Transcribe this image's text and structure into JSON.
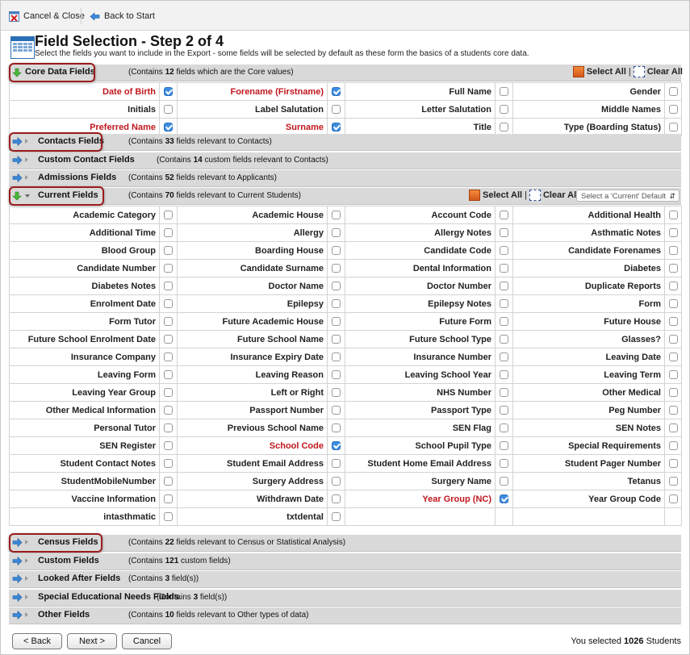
{
  "toolbar": {
    "cancel_close": "Cancel & Close",
    "back_to_start": "Back to Start"
  },
  "header": {
    "title": "Field Selection - Step 2 of 4",
    "subtitle": "Select the fields you want to include in the Export - some fields will be selected by default as these form the basics of a students core data."
  },
  "colors": {
    "accent": "#2a6fb6",
    "required_red": "#c0171e",
    "highlight": "#9b1c1c",
    "section_bg": "#d9d9d9"
  },
  "core": {
    "name": "Core Data Fields",
    "desc_pre": "(Contains ",
    "count": "12",
    "desc_post": " fields which are the Core values)",
    "select_all": "Select All",
    "sep": " | ",
    "clear_all": "Clear All",
    "rows": [
      [
        {
          "label": "Date of Birth",
          "checked": true,
          "red": true
        },
        {
          "label": "Forename (Firstname)",
          "checked": true,
          "red": true
        },
        {
          "label": "Full Name",
          "checked": false,
          "red": false
        },
        {
          "label": "Gender",
          "checked": false,
          "red": false
        }
      ],
      [
        {
          "label": "Initials",
          "checked": false,
          "red": false
        },
        {
          "label": "Label Salutation",
          "checked": false,
          "red": false
        },
        {
          "label": "Letter Salutation",
          "checked": false,
          "red": false
        },
        {
          "label": "Middle Names",
          "checked": false,
          "red": false
        }
      ],
      [
        {
          "label": "Preferred Name",
          "checked": true,
          "red": true
        },
        {
          "label": "Surname",
          "checked": true,
          "red": true
        },
        {
          "label": "Title",
          "checked": false,
          "red": false
        },
        {
          "label": "Type (Boarding Status)",
          "checked": false,
          "red": false
        }
      ]
    ]
  },
  "sections_before": [
    {
      "name": "Contacts Fields",
      "desc_pre": "(Contains ",
      "count": "33",
      "desc_post": " fields relevant to Contacts)"
    },
    {
      "name": "Custom Contact Fields",
      "desc_pre": "(Contains ",
      "count": "14",
      "desc_post": " custom fields relevant to Contacts)"
    },
    {
      "name": "Admissions Fields",
      "desc_pre": "(Contains ",
      "count": "52",
      "desc_post": " fields relevant to Applicants)"
    }
  ],
  "current": {
    "name": "Current Fields",
    "desc_pre": "(Contains ",
    "count": "70",
    "desc_post": " fields relevant to Current Students)",
    "select_all": "Select All",
    "sep": " | ",
    "clear_all": "Clear All",
    "default_placeholder": "Select a 'Current' Default",
    "rows": [
      [
        {
          "label": "Academic Category",
          "checked": false,
          "red": false
        },
        {
          "label": "Academic House",
          "checked": false,
          "red": false
        },
        {
          "label": "Account Code",
          "checked": false,
          "red": false
        },
        {
          "label": "Additional Health",
          "checked": false,
          "red": false
        }
      ],
      [
        {
          "label": "Additional Time",
          "checked": false,
          "red": false
        },
        {
          "label": "Allergy",
          "checked": false,
          "red": false
        },
        {
          "label": "Allergy Notes",
          "checked": false,
          "red": false
        },
        {
          "label": "Asthmatic Notes",
          "checked": false,
          "red": false
        }
      ],
      [
        {
          "label": "Blood Group",
          "checked": false,
          "red": false
        },
        {
          "label": "Boarding House",
          "checked": false,
          "red": false
        },
        {
          "label": "Candidate Code",
          "checked": false,
          "red": false
        },
        {
          "label": "Candidate Forenames",
          "checked": false,
          "red": false
        }
      ],
      [
        {
          "label": "Candidate Number",
          "checked": false,
          "red": false
        },
        {
          "label": "Candidate Surname",
          "checked": false,
          "red": false
        },
        {
          "label": "Dental Information",
          "checked": false,
          "red": false
        },
        {
          "label": "Diabetes",
          "checked": false,
          "red": false
        }
      ],
      [
        {
          "label": "Diabetes Notes",
          "checked": false,
          "red": false
        },
        {
          "label": "Doctor Name",
          "checked": false,
          "red": false
        },
        {
          "label": "Doctor Number",
          "checked": false,
          "red": false
        },
        {
          "label": "Duplicate Reports",
          "checked": false,
          "red": false
        }
      ],
      [
        {
          "label": "Enrolment Date",
          "checked": false,
          "red": false
        },
        {
          "label": "Epilepsy",
          "checked": false,
          "red": false
        },
        {
          "label": "Epilepsy Notes",
          "checked": false,
          "red": false
        },
        {
          "label": "Form",
          "checked": false,
          "red": false
        }
      ],
      [
        {
          "label": "Form Tutor",
          "checked": false,
          "red": false
        },
        {
          "label": "Future Academic House",
          "checked": false,
          "red": false
        },
        {
          "label": "Future Form",
          "checked": false,
          "red": false
        },
        {
          "label": "Future House",
          "checked": false,
          "red": false
        }
      ],
      [
        {
          "label": "Future School Enrolment Date",
          "checked": false,
          "red": false
        },
        {
          "label": "Future School Name",
          "checked": false,
          "red": false
        },
        {
          "label": "Future School Type",
          "checked": false,
          "red": false
        },
        {
          "label": "Glasses?",
          "checked": false,
          "red": false
        }
      ],
      [
        {
          "label": "Insurance Company",
          "checked": false,
          "red": false
        },
        {
          "label": "Insurance Expiry Date",
          "checked": false,
          "red": false
        },
        {
          "label": "Insurance Number",
          "checked": false,
          "red": false
        },
        {
          "label": "Leaving Date",
          "checked": false,
          "red": false
        }
      ],
      [
        {
          "label": "Leaving Form",
          "checked": false,
          "red": false
        },
        {
          "label": "Leaving Reason",
          "checked": false,
          "red": false
        },
        {
          "label": "Leaving School Year",
          "checked": false,
          "red": false
        },
        {
          "label": "Leaving Term",
          "checked": false,
          "red": false
        }
      ],
      [
        {
          "label": "Leaving Year Group",
          "checked": false,
          "red": false
        },
        {
          "label": "Left or Right",
          "checked": false,
          "red": false
        },
        {
          "label": "NHS Number",
          "checked": false,
          "red": false
        },
        {
          "label": "Other Medical",
          "checked": false,
          "red": false
        }
      ],
      [
        {
          "label": "Other Medical Information",
          "checked": false,
          "red": false
        },
        {
          "label": "Passport Number",
          "checked": false,
          "red": false
        },
        {
          "label": "Passport Type",
          "checked": false,
          "red": false
        },
        {
          "label": "Peg Number",
          "checked": false,
          "red": false
        }
      ],
      [
        {
          "label": "Personal Tutor",
          "checked": false,
          "red": false
        },
        {
          "label": "Previous School Name",
          "checked": false,
          "red": false
        },
        {
          "label": "SEN Flag",
          "checked": false,
          "red": false
        },
        {
          "label": "SEN Notes",
          "checked": false,
          "red": false
        }
      ],
      [
        {
          "label": "SEN Register",
          "checked": false,
          "red": false
        },
        {
          "label": "School Code",
          "checked": true,
          "red": true
        },
        {
          "label": "School Pupil Type",
          "checked": false,
          "red": false
        },
        {
          "label": "Special Requirements",
          "checked": false,
          "red": false
        }
      ],
      [
        {
          "label": "Student Contact Notes",
          "checked": false,
          "red": false
        },
        {
          "label": "Student Email Address",
          "checked": false,
          "red": false
        },
        {
          "label": "Student Home Email Address",
          "checked": false,
          "red": false
        },
        {
          "label": "Student Pager Number",
          "checked": false,
          "red": false
        }
      ],
      [
        {
          "label": "StudentMobileNumber",
          "checked": false,
          "red": false
        },
        {
          "label": "Surgery Address",
          "checked": false,
          "red": false
        },
        {
          "label": "Surgery Name",
          "checked": false,
          "red": false
        },
        {
          "label": "Tetanus",
          "checked": false,
          "red": false
        }
      ],
      [
        {
          "label": "Vaccine Information",
          "checked": false,
          "red": false
        },
        {
          "label": "Withdrawn Date",
          "checked": false,
          "red": false
        },
        {
          "label": "Year Group (NC)",
          "checked": true,
          "red": true
        },
        {
          "label": "Year Group Code",
          "checked": false,
          "red": false
        }
      ],
      [
        {
          "label": "intasthmatic",
          "checked": false,
          "red": false
        },
        {
          "label": "txtdental",
          "checked": false,
          "red": false
        },
        null,
        null
      ]
    ]
  },
  "sections_after": [
    {
      "name": "Census Fields",
      "desc_pre": "(Contains ",
      "count": "22",
      "desc_post": " fields relevant to Census or Statistical Analysis)"
    },
    {
      "name": "Custom Fields",
      "desc_pre": "(Contains ",
      "count": "121",
      "desc_post": " custom fields)"
    },
    {
      "name": "Looked After Fields",
      "desc_pre": "(Contains ",
      "count": "3",
      "desc_post": " field(s))"
    },
    {
      "name": "Special Educational Needs Fields",
      "desc_pre": "(Contains ",
      "count": "3",
      "desc_post": " field(s))"
    },
    {
      "name": "Other Fields",
      "desc_pre": "(Contains ",
      "count": "10",
      "desc_post": " fields relevant to Other types of data)"
    }
  ],
  "footer": {
    "back": "< Back",
    "next": "Next >",
    "cancel": "Cancel",
    "status_pre": "You selected ",
    "status_count": "1026",
    "status_post": " Students"
  }
}
